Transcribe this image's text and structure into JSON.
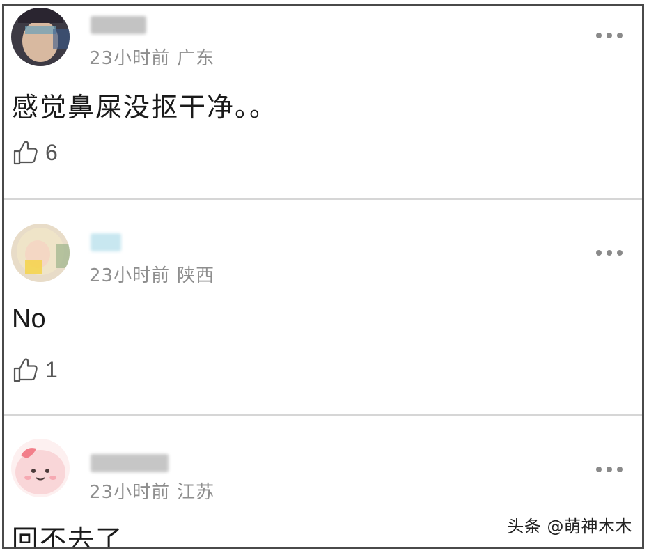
{
  "comments": [
    {
      "time": "23小时前",
      "location": "广东",
      "text": "感觉鼻屎没抠干净。。",
      "likes": "6",
      "avatar_icon": "user-avatar-icon",
      "username_blur_color": "#b9b9b9"
    },
    {
      "time": "23小时前",
      "location": "陕西",
      "text": "No",
      "likes": "1",
      "avatar_icon": "user-avatar-icon",
      "username_blur_color": "#bfe3ee"
    },
    {
      "time": "23小时前",
      "location": "江苏",
      "text": "回不去了",
      "likes": "",
      "avatar_icon": "user-avatar-icon",
      "username_blur_color": "#bdbdbd"
    }
  ],
  "watermark": "头条 @萌神木木",
  "icons": {
    "like": "thumbs-up-icon",
    "more": "more-options-icon"
  }
}
